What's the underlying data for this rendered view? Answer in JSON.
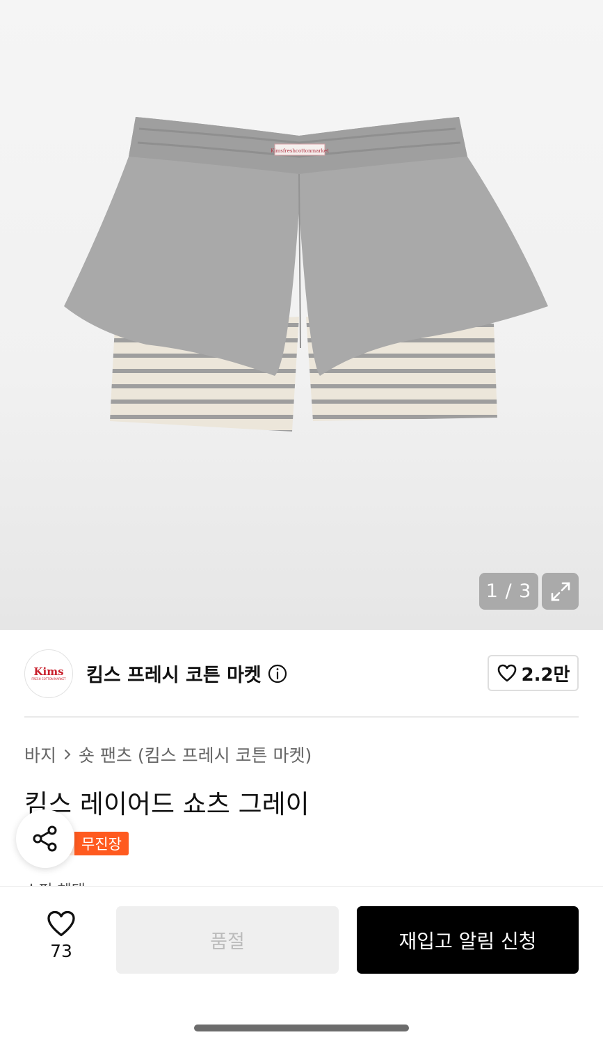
{
  "gallery": {
    "counter": "1 / 3",
    "label_text": "Kimsfreshcottonmarket"
  },
  "brand": {
    "logo_text": "Kims",
    "logo_sub": "FRESH COTTON MARKET",
    "name": "킴스 프레시 코튼 마켓",
    "likes": "2.2만"
  },
  "breadcrumb": {
    "category": "바지",
    "subcategory": "숏 팬츠 (킴스 프레시 코튼 마켓)"
  },
  "product": {
    "title": "킴스 레이어드 쇼츠 그레이",
    "badge": "무진장",
    "peek_text": "쇼핑 혜택"
  },
  "bottom": {
    "wish_count": "73",
    "soldout_label": "품절",
    "restock_label": "재입고 알림 신청"
  },
  "colors": {
    "accent": "#ff5a1f",
    "primary_button": "#000000",
    "brand_red": "#c8202c"
  }
}
